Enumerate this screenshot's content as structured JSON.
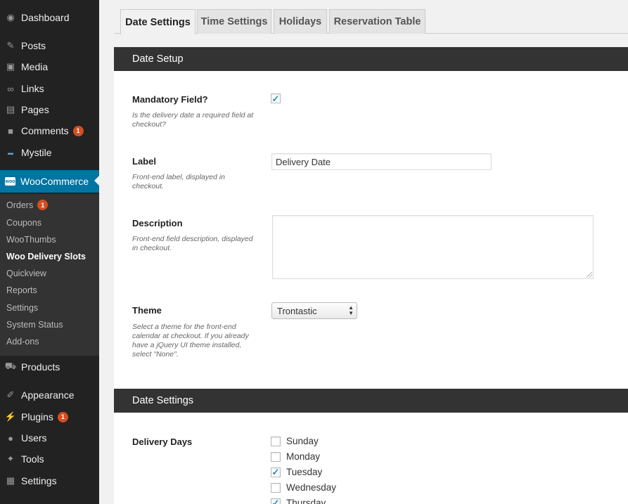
{
  "sidebar": {
    "items": [
      {
        "label": "Dashboard",
        "icon": "dashboard-icon"
      },
      {
        "label": "Posts",
        "icon": "pin-icon"
      },
      {
        "label": "Media",
        "icon": "media-icon"
      },
      {
        "label": "Links",
        "icon": "link-icon"
      },
      {
        "label": "Pages",
        "icon": "pages-icon"
      },
      {
        "label": "Comments",
        "icon": "comment-icon",
        "badge": "1"
      },
      {
        "label": "Mystile",
        "icon": "theme-icon"
      },
      {
        "label": "WooCommerce",
        "icon": "woo-icon",
        "active": true
      },
      {
        "label": "Products",
        "icon": "cart-icon"
      },
      {
        "label": "Appearance",
        "icon": "brush-icon"
      },
      {
        "label": "Plugins",
        "icon": "plugin-icon",
        "badge": "1"
      },
      {
        "label": "Users",
        "icon": "user-icon"
      },
      {
        "label": "Tools",
        "icon": "wrench-icon"
      },
      {
        "label": "Settings",
        "icon": "settings-icon"
      }
    ],
    "submenu": [
      {
        "label": "Orders",
        "badge": "1"
      },
      {
        "label": "Coupons"
      },
      {
        "label": "WooThumbs"
      },
      {
        "label": "Woo Delivery Slots",
        "current": true
      },
      {
        "label": "Quickview"
      },
      {
        "label": "Reports"
      },
      {
        "label": "Settings"
      },
      {
        "label": "System Status"
      },
      {
        "label": "Add-ons"
      }
    ]
  },
  "tabs": [
    {
      "label": "Date Settings",
      "active": true
    },
    {
      "label": "Time Settings"
    },
    {
      "label": "Holidays"
    },
    {
      "label": "Reservation Table"
    }
  ],
  "date_setup": {
    "title": "Date Setup",
    "mandatory": {
      "label": "Mandatory Field?",
      "desc": "Is the delivery date a required field at checkout?",
      "checked": true
    },
    "label_field": {
      "label": "Label",
      "desc": "Front-end label, displayed in checkout.",
      "value": "Delivery Date"
    },
    "description": {
      "label": "Description",
      "desc": "Front-end field description, displayed in checkout.",
      "value": ""
    },
    "theme": {
      "label": "Theme",
      "desc": "Select a theme for the front-end calendar at checkout. If you already have a jQuery UI theme installed, select \"None\".",
      "value": "Trontastic"
    }
  },
  "date_settings": {
    "title": "Date Settings",
    "delivery_days": {
      "label": "Delivery Days",
      "days": [
        {
          "label": "Sunday",
          "checked": false
        },
        {
          "label": "Monday",
          "checked": false
        },
        {
          "label": "Tuesday",
          "checked": true
        },
        {
          "label": "Wednesday",
          "checked": false
        },
        {
          "label": "Thursday",
          "checked": true
        }
      ]
    }
  }
}
